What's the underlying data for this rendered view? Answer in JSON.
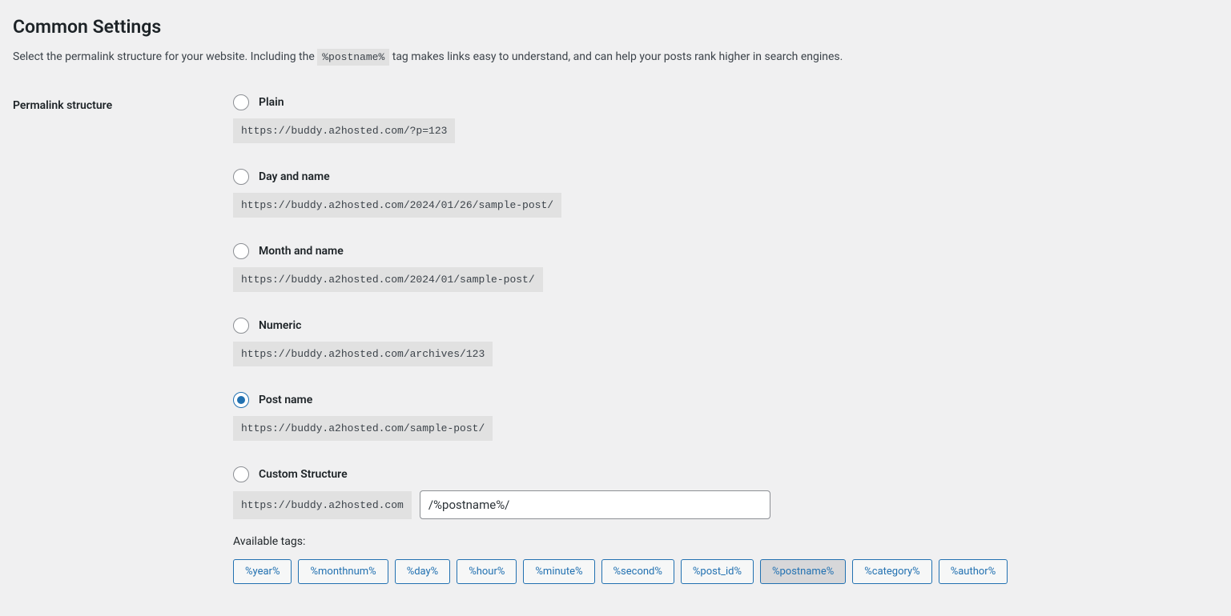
{
  "section": {
    "title": "Common Settings",
    "description_before": "Select the permalink structure for your website. Including the ",
    "description_tag": "%postname%",
    "description_after": " tag makes links easy to understand, and can help your posts rank higher in search engines."
  },
  "row_label": "Permalink structure",
  "options": [
    {
      "id": "plain",
      "label": "Plain",
      "example": "https://buddy.a2hosted.com/?p=123",
      "checked": false
    },
    {
      "id": "day-name",
      "label": "Day and name",
      "example": "https://buddy.a2hosted.com/2024/01/26/sample-post/",
      "checked": false
    },
    {
      "id": "month-name",
      "label": "Month and name",
      "example": "https://buddy.a2hosted.com/2024/01/sample-post/",
      "checked": false
    },
    {
      "id": "numeric",
      "label": "Numeric",
      "example": "https://buddy.a2hosted.com/archives/123",
      "checked": false
    },
    {
      "id": "post-name",
      "label": "Post name",
      "example": "https://buddy.a2hosted.com/sample-post/",
      "checked": true
    },
    {
      "id": "custom",
      "label": "Custom Structure",
      "checked": false
    }
  ],
  "custom": {
    "base_url": "https://buddy.a2hosted.com",
    "input_value": "/%postname%/",
    "available_label": "Available tags:"
  },
  "tags": [
    {
      "label": "%year%",
      "active": false
    },
    {
      "label": "%monthnum%",
      "active": false
    },
    {
      "label": "%day%",
      "active": false
    },
    {
      "label": "%hour%",
      "active": false
    },
    {
      "label": "%minute%",
      "active": false
    },
    {
      "label": "%second%",
      "active": false
    },
    {
      "label": "%post_id%",
      "active": false
    },
    {
      "label": "%postname%",
      "active": true
    },
    {
      "label": "%category%",
      "active": false
    },
    {
      "label": "%author%",
      "active": false
    }
  ]
}
